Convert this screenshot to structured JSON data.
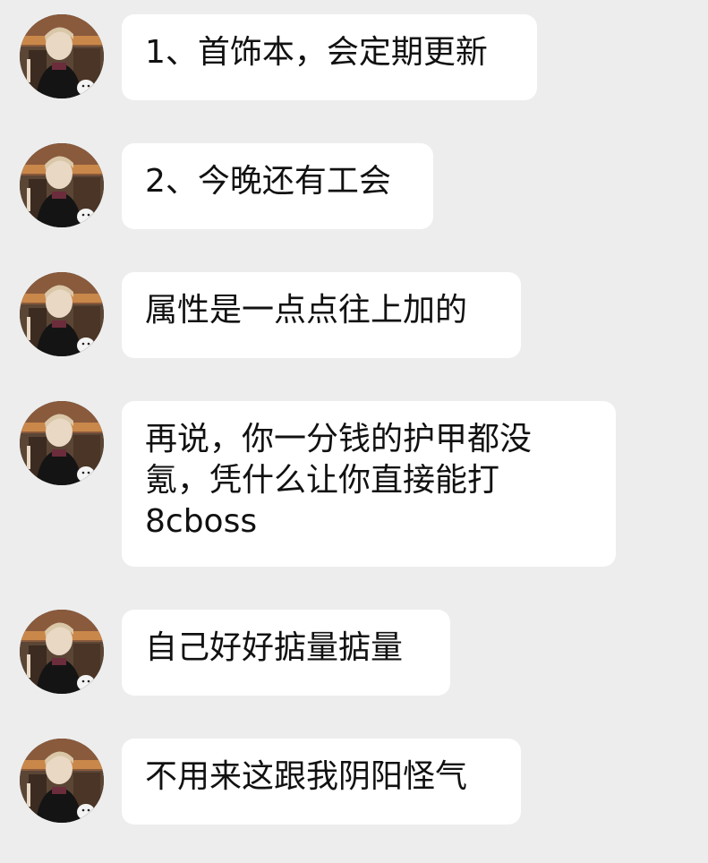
{
  "messages": [
    {
      "text": "1、首饰本，会定期更新"
    },
    {
      "text": "2、今晚还有工会"
    },
    {
      "text": "属性是一点点往上加的"
    },
    {
      "text": "再说，你一分钱的护甲都没\n氪，凭什么让你直接能打\n8cboss"
    },
    {
      "text": "自己好好掂量掂量"
    },
    {
      "text": "不用来这跟我阴阳怪气"
    }
  ],
  "colors": {
    "background": "#ededed",
    "bubble": "#ffffff",
    "text": "#111111"
  }
}
